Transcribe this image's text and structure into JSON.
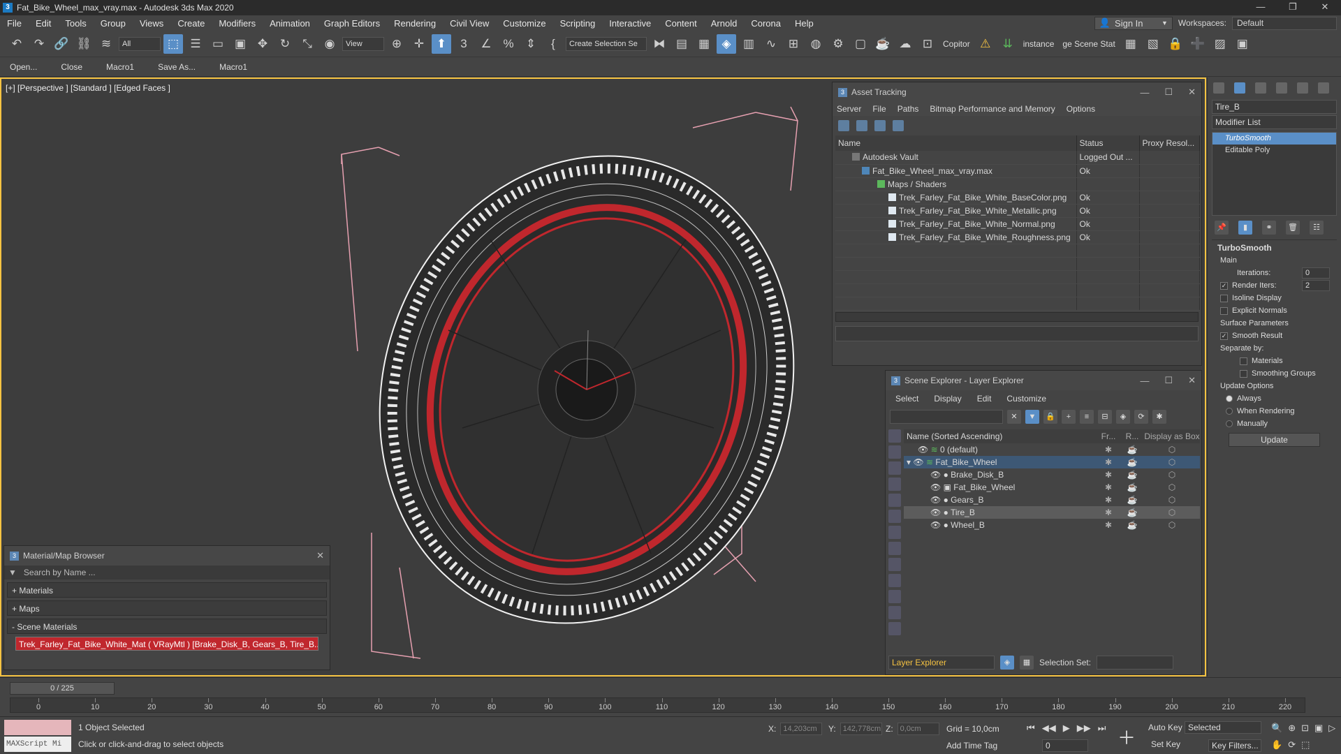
{
  "window": {
    "title": "Fat_Bike_Wheel_max_vray.max - Autodesk 3ds Max 2020",
    "app_icon": "3",
    "min": "—",
    "max": "❐",
    "close": "✕"
  },
  "menu": [
    "File",
    "Edit",
    "Tools",
    "Group",
    "Views",
    "Create",
    "Modifiers",
    "Animation",
    "Graph Editors",
    "Rendering",
    "Civil View",
    "Customize",
    "Scripting",
    "Interactive",
    "Content",
    "Arnold",
    "Corona",
    "Help"
  ],
  "account": {
    "sign_in": "Sign In",
    "workspaces_label": "Workspaces:",
    "workspace_value": "Default"
  },
  "toolbar": {
    "filter_value": "All",
    "view_value": "View",
    "create_selection": "Create Selection Se",
    "copitor": "Copitor",
    "instance": "instance",
    "scene_state": "ge Scene Stat"
  },
  "toolbar2": [
    "Open...",
    "Close",
    "Macro1",
    "Save As...",
    "Macro1"
  ],
  "viewport": {
    "label": "[+] [Perspective ] [Standard ] [Edged Faces ]"
  },
  "asset_tracking": {
    "title": "Asset Tracking",
    "menu": [
      "Server",
      "File",
      "Paths",
      "Bitmap Performance and Memory",
      "Options"
    ],
    "columns": [
      "Name",
      "Status",
      "Proxy Resol..."
    ],
    "rows": [
      {
        "name": "Autodesk Vault",
        "status": "Logged Out ...",
        "indent": 0
      },
      {
        "name": "Fat_Bike_Wheel_max_vray.max",
        "status": "Ok",
        "indent": 1
      },
      {
        "name": "Maps / Shaders",
        "status": "",
        "indent": 2
      },
      {
        "name": "Trek_Farley_Fat_Bike_White_BaseColor.png",
        "status": "Ok",
        "indent": 3
      },
      {
        "name": "Trek_Farley_Fat_Bike_White_Metallic.png",
        "status": "Ok",
        "indent": 3
      },
      {
        "name": "Trek_Farley_Fat_Bike_White_Normal.png",
        "status": "Ok",
        "indent": 3
      },
      {
        "name": "Trek_Farley_Fat_Bike_White_Roughness.png",
        "status": "Ok",
        "indent": 3
      }
    ]
  },
  "scene_explorer": {
    "title": "Scene Explorer - Layer Explorer",
    "menu": [
      "Select",
      "Display",
      "Edit",
      "Customize"
    ],
    "columns": {
      "name": "Name (Sorted Ascending)",
      "frozen": "Fr...",
      "render": "R...",
      "box": "Display as Box"
    },
    "rows": [
      {
        "name": "0 (default)",
        "indent": 1,
        "state": ""
      },
      {
        "name": "Fat_Bike_Wheel",
        "indent": 1,
        "state": "sel"
      },
      {
        "name": "Brake_Disk_B",
        "indent": 2,
        "state": ""
      },
      {
        "name": "Fat_Bike_Wheel",
        "indent": 2,
        "state": ""
      },
      {
        "name": "Gears_B",
        "indent": 2,
        "state": ""
      },
      {
        "name": "Tire_B",
        "indent": 2,
        "state": "hl"
      },
      {
        "name": "Wheel_B",
        "indent": 2,
        "state": ""
      }
    ],
    "footer": {
      "explorer": "Layer Explorer",
      "selection_set_label": "Selection Set:"
    }
  },
  "material_browser": {
    "title": "Material/Map Browser",
    "search_placeholder": "Search by Name ...",
    "groups": [
      "+ Materials",
      "+ Maps",
      "- Scene Materials"
    ],
    "item": "Trek_Farley_Fat_Bike_White_Mat ( VRayMtl ) [Brake_Disk_B, Gears_B, Tire_B..."
  },
  "command_panel": {
    "object_name": "Tire_B",
    "modifier_list": "Modifier List",
    "modifiers": [
      {
        "name": "TurboSmooth",
        "sel": true
      },
      {
        "name": "Editable Poly",
        "sel": false
      }
    ],
    "turbosmooth": {
      "title": "TurboSmooth",
      "main": "Main",
      "iterations_label": "Iterations:",
      "iterations": "0",
      "render_iters_label": "Render Iters:",
      "render_iters": "2",
      "isoline": "Isoline Display",
      "explicit": "Explicit Normals",
      "surface": "Surface Parameters",
      "smooth_result": "Smooth Result",
      "separate": "Separate by:",
      "materials": "Materials",
      "smoothing": "Smoothing Groups",
      "update_options": "Update Options",
      "always": "Always",
      "when_rendering": "When Rendering",
      "manually": "Manually",
      "update": "Update"
    }
  },
  "timeline": {
    "position": "0 / 225",
    "labels": [
      "0",
      "10",
      "20",
      "30",
      "40",
      "50",
      "60",
      "70",
      "80",
      "90",
      "100",
      "110",
      "120",
      "130",
      "140",
      "150",
      "160",
      "170",
      "180",
      "190",
      "200",
      "210",
      "220"
    ]
  },
  "status": {
    "maxscript": "MAXScript Mi",
    "selected": "1 Object Selected",
    "prompt": "Click or click-and-drag to select objects",
    "x_label": "X:",
    "x": "14,203cm",
    "y_label": "Y:",
    "y": "142,778cm",
    "z_label": "Z:",
    "z": "0,0cm",
    "grid": "Grid = 10,0cm",
    "add_time_tag": "Add Time Tag",
    "auto_key": "Auto Key",
    "set_key": "Set Key",
    "selected_dropdown": "Selected",
    "key_filters": "Key Filters...",
    "frame": "0"
  },
  "colors": {
    "accent": "#5a8fc7",
    "viewport_border": "#f6c342",
    "wire_red": "#c0272d"
  }
}
